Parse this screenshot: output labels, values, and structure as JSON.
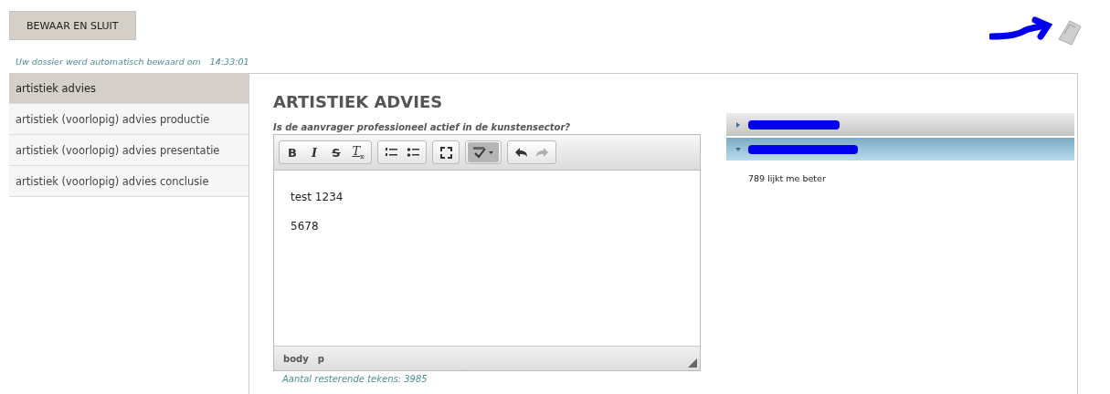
{
  "save_button": {
    "label": "BEWAAR EN SLUIT"
  },
  "autosave": {
    "message": "Uw dossier werd automatisch bewaard om",
    "time": "14:33:01"
  },
  "sidebar": {
    "items": [
      {
        "label": "artistiek advies",
        "selected": true
      },
      {
        "label": "artistiek (voorlopig) advies productie",
        "selected": false
      },
      {
        "label": "artistiek (voorlopig) advies presentatie",
        "selected": false
      },
      {
        "label": "artistiek (voorlopig) advies conclusie",
        "selected": false
      }
    ]
  },
  "main": {
    "title": "ARTISTIEK ADVIES",
    "question": "Is de aanvrager professioneel actief in de kunstensector?",
    "editor": {
      "toolbar": [
        {
          "group": [
            {
              "kind": "bold",
              "label": "B",
              "on": false
            },
            {
              "kind": "italic",
              "label": "I",
              "on": false
            },
            {
              "kind": "strike",
              "label": "S",
              "on": false
            },
            {
              "kind": "clear",
              "label": "T",
              "sub": "x",
              "on": false
            }
          ]
        },
        {
          "group": [
            {
              "kind": "numbered",
              "on": false
            },
            {
              "kind": "bulleted",
              "on": false
            }
          ]
        },
        {
          "group": [
            {
              "kind": "maximize",
              "on": false
            }
          ]
        },
        {
          "group": [
            {
              "kind": "spellcheck",
              "on": true
            }
          ]
        },
        {
          "group": [
            {
              "kind": "undo",
              "on": false,
              "disabled": false
            },
            {
              "kind": "redo",
              "on": false,
              "disabled": true
            }
          ]
        }
      ],
      "paragraphs": [
        "test 1234",
        "5678"
      ],
      "path": [
        "body",
        "p"
      ]
    },
    "remaining": "Aantal resterende tekens: 3985"
  },
  "comments": {
    "panels": [
      {
        "expanded": false
      },
      {
        "expanded": true,
        "content": "789 lijkt me beter"
      }
    ]
  }
}
